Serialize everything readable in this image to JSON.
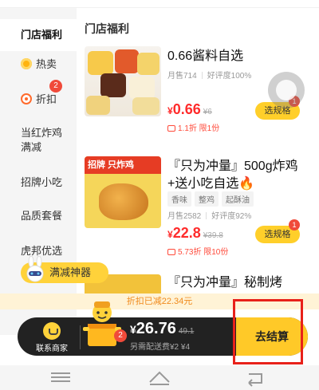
{
  "sidebar": {
    "items": [
      {
        "label": "门店福利"
      },
      {
        "label": "热卖"
      },
      {
        "label": "折扣",
        "badge": "2"
      },
      {
        "label": "当红炸鸡满减"
      },
      {
        "label": "招牌小吃"
      },
      {
        "label": "品质套餐"
      },
      {
        "label": "虎邦优选"
      }
    ]
  },
  "main": {
    "section_title": "门店福利",
    "products": [
      {
        "title": "0.66酱料自选",
        "sales": "月售714",
        "rating": "好评度100%",
        "price_symbol": "¥",
        "price": "0.66",
        "orig_price": "¥6",
        "promo": "1.1折 限1份",
        "spec_label": "选规格",
        "spec_badge": "1"
      },
      {
        "title": "『只为冲量』500g炸鸡+送小吃自选🔥",
        "sales": "月售2582",
        "rating": "好评度92%",
        "tags": [
          "香味",
          "整鸡",
          "起酥油"
        ],
        "price_symbol": "¥",
        "price": "22.8",
        "orig_price": "¥39.8",
        "promo": "5.73折 限10份",
        "spec_label": "选规格",
        "spec_badge": "1",
        "image_text": "招牌 只炸鸡"
      },
      {
        "title": "『只为冲量』秘制烤"
      }
    ]
  },
  "promo_pill": {
    "label": "满减神器"
  },
  "discount_bar": {
    "text": "折扣已减22.34元"
  },
  "cart_bar": {
    "contact_label": "联系商家",
    "cart_count": "2",
    "price_symbol": "¥",
    "total": "26.76",
    "orig_total": "49.1",
    "delivery_text": "另需配送费¥2 ¥4",
    "checkout_label": "去结算"
  },
  "colors": {
    "accent_yellow": "#ffc928",
    "price_red": "#ff2b2b",
    "badge_red": "#f04a3a",
    "highlight_frame": "#e8211a"
  },
  "icons": [
    "hot-flame-icon",
    "discount-icon",
    "contact-merchant-icon",
    "cart-mascot-icon",
    "menu-icon",
    "home-icon",
    "back-icon"
  ]
}
